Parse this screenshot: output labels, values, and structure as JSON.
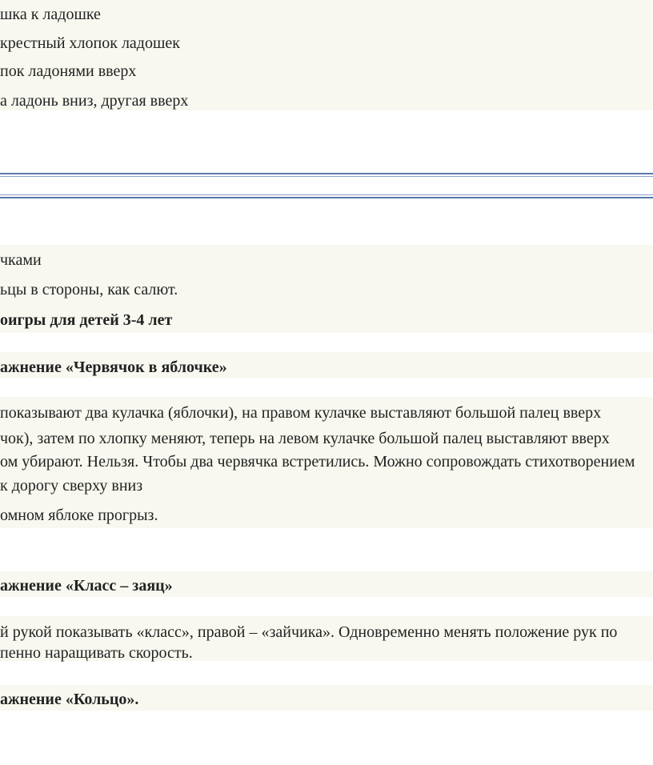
{
  "top_list": [
    "шка к ладошке",
    "крестный хлопок ладошек",
    "пок ладонями вверх",
    "а ладонь вниз, другая вверх"
  ],
  "section2": {
    "line1": "чками",
    "line2": "ьцы в стороны, как салют.",
    "heading": "оигры для детей 3-4 лет"
  },
  "exercise_worm": {
    "heading": "ажнение «Червячок в яблочке»",
    "paragraph": [
      "показывают два кулачка (яблочки), на правом кулачке выставляют большой палец вверх",
      "чок), затем по хлопку меняют, теперь на левом кулачке большой палец выставляют вверх",
      "ом убирают. Нельзя. Чтобы два червячка встретились. Можно сопровождать стихотворением",
      "к дорогу сверху вниз",
      "омном яблоке прогрыз."
    ]
  },
  "exercise_class": {
    "heading": "ажнение «Класс – заяц»",
    "paragraph": [
      "й рукой показывать «класс», правой – «зайчика». Одновременно менять положение рук по",
      "пенно наращивать скорость."
    ]
  },
  "exercise_ring": {
    "heading": "ажнение «Кольцо»."
  }
}
